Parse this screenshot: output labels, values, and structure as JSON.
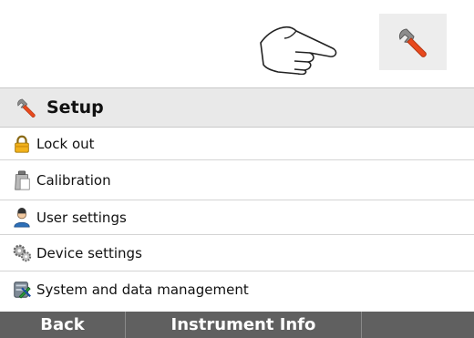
{
  "gesture": {
    "icon": "pointing-hand-icon"
  },
  "shortcut": {
    "icon": "wrench-icon"
  },
  "panel": {
    "title": "Setup",
    "title_icon": "wrench-icon",
    "items": [
      {
        "label": "Lock out",
        "icon": "padlock-icon"
      },
      {
        "label": "Calibration",
        "icon": "calibration-weight-icon"
      },
      {
        "label": "User settings",
        "icon": "user-icon"
      },
      {
        "label": "Device settings",
        "icon": "gears-icon"
      },
      {
        "label": "System and data management",
        "icon": "system-data-icon"
      }
    ]
  },
  "footer": {
    "back_label": "Back",
    "info_label": "Instrument Info"
  },
  "colors": {
    "footer_bg": "#606060",
    "header_bg": "#e9e9e9",
    "wrench_handle": "#e8491d"
  }
}
